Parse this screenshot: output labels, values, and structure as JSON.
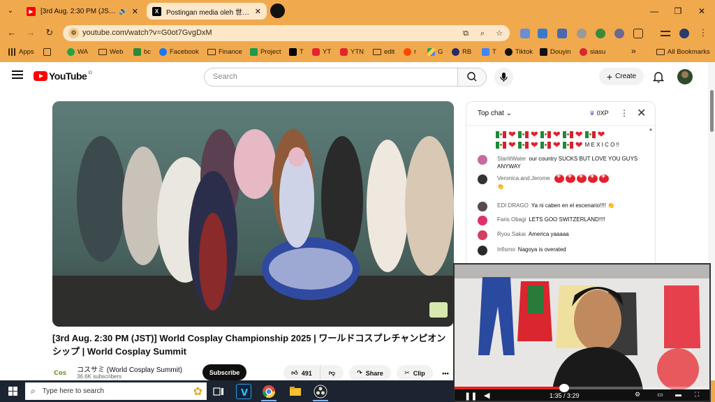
{
  "browser": {
    "tabs": [
      {
        "title": "[3rd Aug. 2:30 PM (JST)] World C",
        "favicon_color": "#ff0000",
        "active": false,
        "audio": true
      },
      {
        "title": "Postingan media oleh 世界コスプ",
        "favicon_color": "#000000",
        "active": true,
        "audio": false
      }
    ],
    "tab_close": "✕",
    "window_controls": {
      "minimize": "—",
      "restore": "❐",
      "close": "✕"
    },
    "url": "youtube.com/watch?v=G0ot7GvgDxM",
    "bookmarks": [
      {
        "label": "Apps",
        "icon": "apps-icon"
      },
      {
        "label": "",
        "icon": "grid-icon"
      },
      {
        "label": "WA",
        "icon": "whatsapp-icon"
      },
      {
        "label": "Web",
        "icon": "folder-icon"
      },
      {
        "label": "bc",
        "icon": "bc-icon"
      },
      {
        "label": "Facebook",
        "icon": "facebook-icon"
      },
      {
        "label": "Finance",
        "icon": "folder-icon"
      },
      {
        "label": "Project",
        "icon": "sheets-icon"
      },
      {
        "label": "T",
        "icon": "x-icon"
      },
      {
        "label": "YT",
        "icon": "youtube-icon"
      },
      {
        "label": "YTN",
        "icon": "youtube-icon"
      },
      {
        "label": "edit",
        "icon": "folder-icon"
      },
      {
        "label": "r",
        "icon": "reddit-icon"
      },
      {
        "label": "G",
        "icon": "drive-icon"
      },
      {
        "label": "RB",
        "icon": "rb-icon"
      },
      {
        "label": "T",
        "icon": "translate-icon"
      },
      {
        "label": "Tiktok",
        "icon": "tiktok-icon"
      },
      {
        "label": "Douyin",
        "icon": "douyin-icon"
      },
      {
        "label": "siasu",
        "icon": "siasu-icon"
      }
    ],
    "overflow": "»",
    "all_bookmarks": "All Bookmarks",
    "accent_color": "#f1a94e"
  },
  "youtube": {
    "logo_text": "YouTube",
    "region": "ID",
    "search_placeholder": "Search",
    "create_label": "Create",
    "video": {
      "title": "[3rd Aug. 2:30 PM (JST)] World Cosplay Championship 2025 | ワールドコスプレチャンピオンシップ | World Cosplay Summit",
      "channel_name": "コスサミ (World Cosplay Summit)",
      "subscribers": "36.6K subscribers",
      "subscribe_label": "Subscribe",
      "likes": "491",
      "share_label": "Share",
      "clip_label": "Clip",
      "more": "•••"
    },
    "chat": {
      "header": "Top chat",
      "xp": "0XP",
      "mexico_text": "M E X I C O !!",
      "messages": [
        {
          "author": "StarlitWater",
          "text": "our country SUCKS BUT LOVE YOU GUYS ANYWAY",
          "color": "#c86aa0"
        },
        {
          "author": "Veronica.and.Jerome",
          "text": "",
          "color": "#333333",
          "swiss": 5
        },
        {
          "author": "EDI DRAGO",
          "text": "Ya ni caben en el escenario!!!!",
          "color": "#5a4a4a"
        },
        {
          "author": "Faris Obagi",
          "text": "LETS GOO SWITZERLAND!!!!",
          "color": "#e0306a"
        },
        {
          "author": "Ryou Sakai",
          "text": "America yaaaaa",
          "color": "#d04060"
        },
        {
          "author": "Infismo",
          "text": "Nagoya is overated",
          "color": "#2a2a2a"
        }
      ]
    }
  },
  "webcam": {
    "time": "1:35 / 3:29"
  },
  "taskbar": {
    "search_placeholder": "Type here to search"
  }
}
